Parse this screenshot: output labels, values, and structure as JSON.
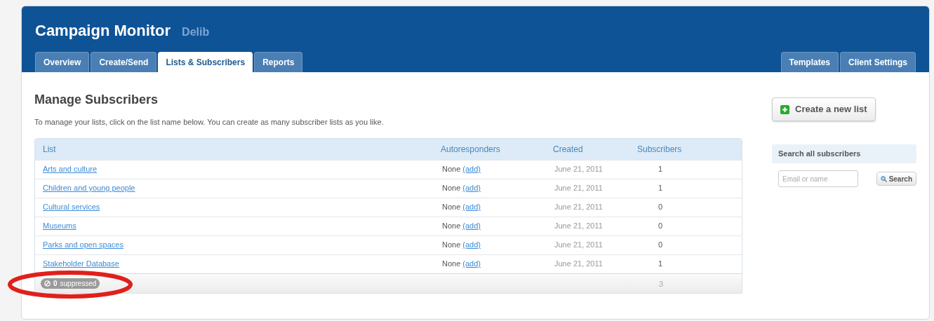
{
  "header": {
    "title": "Campaign Monitor",
    "client": "Delib"
  },
  "tabs": [
    {
      "label": "Overview",
      "selected": false
    },
    {
      "label": "Create/Send",
      "selected": false
    },
    {
      "label": "Lists & Subscribers",
      "selected": true
    },
    {
      "label": "Reports",
      "selected": false
    }
  ],
  "right_tabs": [
    {
      "label": "Templates",
      "selected": false
    },
    {
      "label": "Client Settings",
      "selected": false
    }
  ],
  "page": {
    "title": "Manage Subscribers",
    "intro": "To manage your lists, click on the list name below. You can create as many subscriber lists as you like."
  },
  "table": {
    "columns": [
      "List",
      "Autoresponders",
      "Created",
      "Subscribers"
    ],
    "rows": [
      {
        "name": "Arts and culture",
        "autoresponders": "None",
        "add": "(add)",
        "created": "June 21, 2011",
        "subscribers": "1"
      },
      {
        "name": "Children and young people",
        "autoresponders": "None",
        "add": "(add)",
        "created": "June 21, 2011",
        "subscribers": "1"
      },
      {
        "name": "Cultural services",
        "autoresponders": "None",
        "add": "(add)",
        "created": "June 21, 2011",
        "subscribers": "0"
      },
      {
        "name": "Museums",
        "autoresponders": "None",
        "add": "(add)",
        "created": "June 21, 2011",
        "subscribers": "0"
      },
      {
        "name": "Parks and open spaces",
        "autoresponders": "None",
        "add": "(add)",
        "created": "June 21, 2011",
        "subscribers": "0"
      },
      {
        "name": "Stakeholder Database",
        "autoresponders": "None",
        "add": "(add)",
        "created": "June 21, 2011",
        "subscribers": "1"
      }
    ],
    "footer": {
      "suppressed_count": "0",
      "suppressed_label": "suppressed",
      "total": "3"
    }
  },
  "sidebar": {
    "create_button": "Create a new list",
    "search_title": "Search all subscribers",
    "search_placeholder": "Email or name",
    "search_button": "Search"
  }
}
